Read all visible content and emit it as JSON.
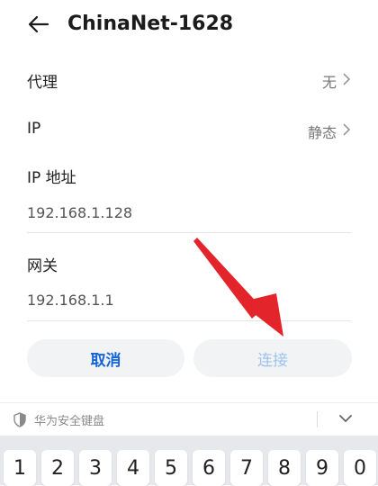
{
  "header": {
    "title": "ChinaNet-1628"
  },
  "rows": {
    "proxy_label": "代理",
    "proxy_value": "无",
    "ip_label": "IP",
    "ip_value": "静态",
    "ip_address_label": "IP 地址",
    "ip_address_value": "192.168.1.128",
    "gateway_label": "网关",
    "gateway_value": "192.168.1.1"
  },
  "buttons": {
    "cancel": "取消",
    "connect": "连接"
  },
  "keyboard": {
    "title": "华为安全键盘",
    "keys": [
      "1",
      "2",
      "3",
      "4",
      "5",
      "6",
      "7",
      "8",
      "9",
      "0"
    ]
  },
  "colors": {
    "accent": "#1565d8",
    "annotation_arrow": "#e3252b"
  }
}
